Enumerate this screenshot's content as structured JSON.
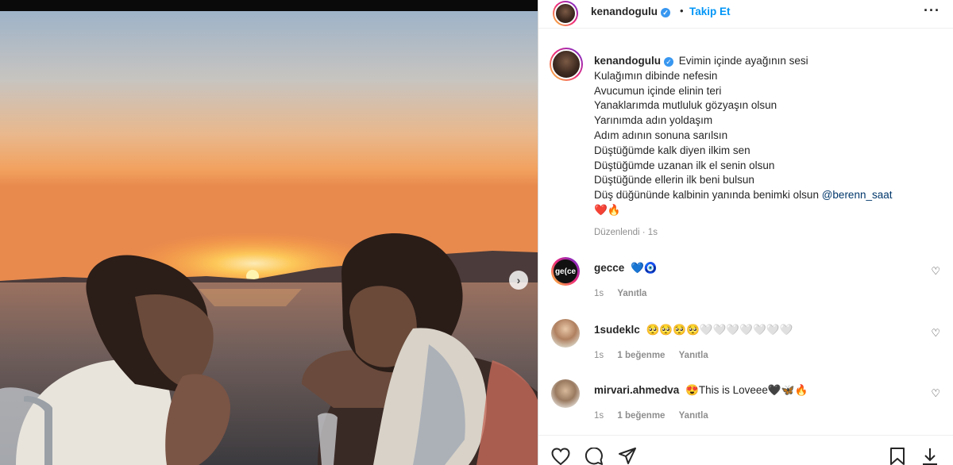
{
  "post_author": {
    "username": "kenandogulu",
    "verified_mark": "✓",
    "separator": "•",
    "follow_label": "Takip Et",
    "more_label": "···"
  },
  "caption": {
    "username": "kenandogulu",
    "lines": [
      "Evimin içinde ayağının sesi",
      "Kulağımın dibinde nefesin",
      "Avucumun içinde elinin teri",
      "Yanaklarımda mutluluk gözyaşın olsun",
      "Yarınımda adın yoldaşım",
      "Adım adının sonuna sarılsın",
      "Düştüğümde kalk diyen ilkim sen",
      "Düştüğümde uzanan ilk el senin olsun",
      "Düştüğünde ellerin ilk beni bulsun",
      "Düş düğününde kalbinin yanında benimki olsun"
    ],
    "mention": "@berenn_saat",
    "emoji": "❤️🔥",
    "edited_label": "Düzenlendi",
    "dot": "·",
    "time": "1s"
  },
  "comments": [
    {
      "username": "gecce",
      "text": "💙🧿",
      "time": "1s",
      "likes": "",
      "reply_label": "Yanıtla",
      "avatar_text": "ge(ce"
    },
    {
      "username": "1sudekl​c",
      "text": "🥺🥺🥺🥺🤍🤍🤍🤍🤍🤍🤍",
      "time": "1s",
      "likes": "1 beğenme",
      "reply_label": "Yanıtla",
      "avatar_text": ""
    },
    {
      "username": "mirvari.ahmedva",
      "text": "😍This is Loveee🖤🦋🔥",
      "time": "1s",
      "likes": "1 beğenme",
      "reply_label": "Yanıtla",
      "avatar_text": ""
    }
  ],
  "icons": {
    "next": "›",
    "heart_outline": "♡"
  },
  "colors": {
    "link_blue": "#0095f6",
    "verified_blue": "#3897f0",
    "mention_blue": "#00376b",
    "muted_gray": "#8e8e8e"
  }
}
